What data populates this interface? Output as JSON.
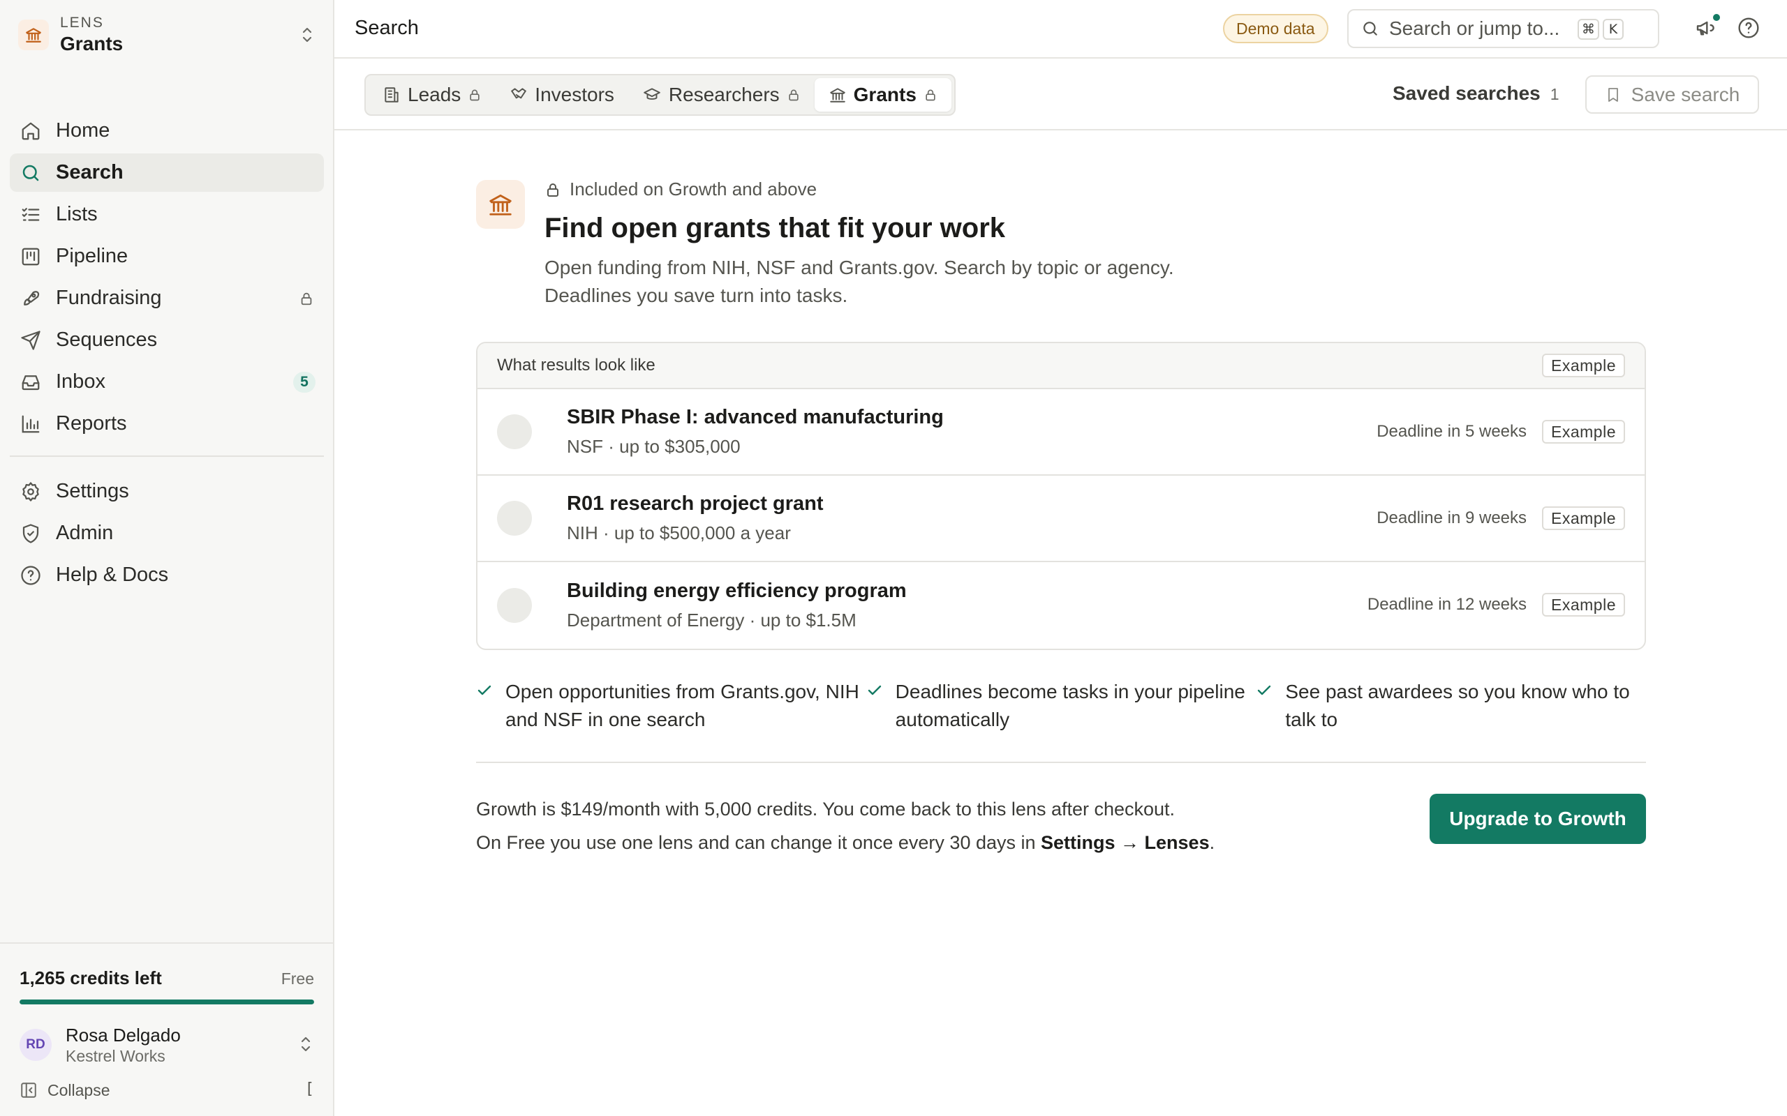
{
  "sidebar": {
    "lens_caption": "LENS",
    "lens_name": "Grants",
    "nav": [
      {
        "label": "Home",
        "icon": "home-icon"
      },
      {
        "label": "Search",
        "icon": "search-icon",
        "active": true
      },
      {
        "label": "Lists",
        "icon": "list-icon"
      },
      {
        "label": "Pipeline",
        "icon": "pipeline-icon"
      },
      {
        "label": "Fundraising",
        "icon": "rocket-icon",
        "locked": true
      },
      {
        "label": "Sequences",
        "icon": "send-icon"
      },
      {
        "label": "Inbox",
        "icon": "inbox-icon",
        "badge": "5"
      },
      {
        "label": "Reports",
        "icon": "bar-chart-icon"
      }
    ],
    "nav_secondary": [
      {
        "label": "Settings",
        "icon": "gear-icon"
      },
      {
        "label": "Admin",
        "icon": "shield-icon"
      },
      {
        "label": "Help & Docs",
        "icon": "help-circle-icon"
      }
    ],
    "credits_text": "1,265 credits left",
    "plan": "Free",
    "credits_fraction": 1.0,
    "user": {
      "initials": "RD",
      "name": "Rosa Delgado",
      "org": "Kestrel Works"
    },
    "collapse_label": "Collapse",
    "collapse_key": "["
  },
  "topbar": {
    "title": "Search",
    "demo_badge": "Demo data",
    "search_placeholder": "Search or jump to...",
    "shortcut_keys": [
      "⌘",
      "K"
    ]
  },
  "tabs": [
    {
      "label": "Leads",
      "icon": "building-icon",
      "locked": true
    },
    {
      "label": "Investors",
      "icon": "handshake-icon",
      "locked": false
    },
    {
      "label": "Researchers",
      "icon": "graduation-cap-icon",
      "locked": true
    },
    {
      "label": "Grants",
      "icon": "landmark-icon",
      "locked": true,
      "active": true
    }
  ],
  "saved_searches": {
    "label": "Saved searches",
    "count": "1"
  },
  "save_search_label": "Save search",
  "hero": {
    "plan_note": "Included on Growth and above",
    "title": "Find open grants that fit your work",
    "description_line1": "Open funding from NIH, NSF and Grants.gov. Search by topic or agency.",
    "description_line2": "Deadlines you save turn into tasks."
  },
  "example_card": {
    "header": "What results look like",
    "tag": "Example",
    "results": [
      {
        "title": "SBIR Phase I: advanced manufacturing",
        "subtitle": "NSF · up to $305,000",
        "deadline": "Deadline in 5 weeks",
        "tag": "Example"
      },
      {
        "title": "R01 research project grant",
        "subtitle": "NIH · up to $500,000 a year",
        "deadline": "Deadline in 9 weeks",
        "tag": "Example"
      },
      {
        "title": "Building energy efficiency program",
        "subtitle": "Department of Energy · up to $1.5M",
        "deadline": "Deadline in 12 weeks",
        "tag": "Example"
      }
    ]
  },
  "features": [
    "Open opportunities from Grants.gov, NIH and NSF in one search",
    "Deadlines become tasks in your pipeline automatically",
    "See past awardees so you know who to talk to"
  ],
  "pricing": {
    "line1": "Growth is $149/month with 5,000 credits. You come back to this lens after checkout.",
    "line2_prefix": "On Free you use one lens and can change it once every 30 days in ",
    "line2_link": "Settings → Lenses",
    "line2_suffix": "."
  },
  "upgrade_label": "Upgrade to Growth",
  "colors": {
    "accent": "#137a63",
    "lens_icon_bg": "#fbeee3",
    "lens_icon": "#c1611a",
    "demo_badge_bg": "#fdf5e4"
  }
}
